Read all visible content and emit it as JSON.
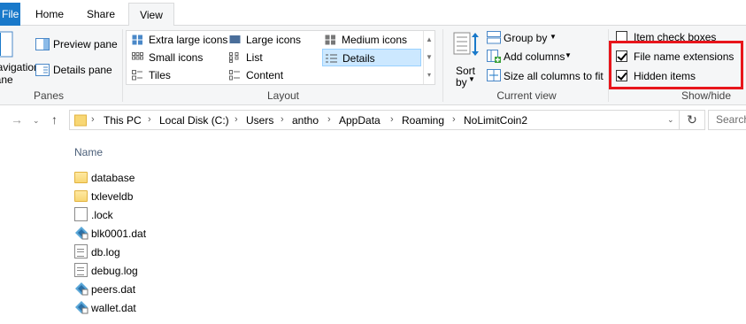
{
  "tabs": {
    "file": "File",
    "home": "Home",
    "share": "Share",
    "view": "View"
  },
  "ribbon": {
    "panes": {
      "navigation_line1": "Navigation",
      "navigation_line2": "pane",
      "preview": "Preview pane",
      "details": "Details pane",
      "group": "Panes"
    },
    "layout": {
      "items": [
        "Extra large icons",
        "Large icons",
        "Medium icons",
        "Small icons",
        "List",
        "Details",
        "Tiles",
        "Content"
      ],
      "selected": "Details",
      "group": "Layout"
    },
    "current_view": {
      "sort_line1": "Sort",
      "sort_line2": "by",
      "group_by": "Group by",
      "add_columns": "Add columns",
      "size_all": "Size all columns to fit",
      "group": "Current view"
    },
    "show_hide": {
      "item_checkboxes": "Item check boxes",
      "file_name_extensions": "File name extensions",
      "hidden_items": "Hidden items",
      "group": "Show/hide",
      "item_checkboxes_checked": false,
      "file_name_extensions_checked": true,
      "hidden_items_checked": true
    }
  },
  "address": {
    "crumbs": [
      "This PC",
      "Local Disk (C:)",
      "Users",
      "antho",
      "AppData",
      "Roaming",
      "NoLimitCoin2"
    ],
    "search_placeholder": "Search"
  },
  "filelist": {
    "column_name": "Name",
    "files": [
      {
        "name": "database",
        "type": "folder"
      },
      {
        "name": "txleveldb",
        "type": "folder"
      },
      {
        "name": ".lock",
        "type": "blank"
      },
      {
        "name": "blk0001.dat",
        "type": "dat"
      },
      {
        "name": "db.log",
        "type": "text"
      },
      {
        "name": "debug.log",
        "type": "text"
      },
      {
        "name": "peers.dat",
        "type": "dat"
      },
      {
        "name": "wallet.dat",
        "type": "dat"
      }
    ]
  },
  "colors": {
    "file_tab": "#1979ca",
    "highlight": "#e8151b",
    "selected_bg": "#cce8ff"
  }
}
